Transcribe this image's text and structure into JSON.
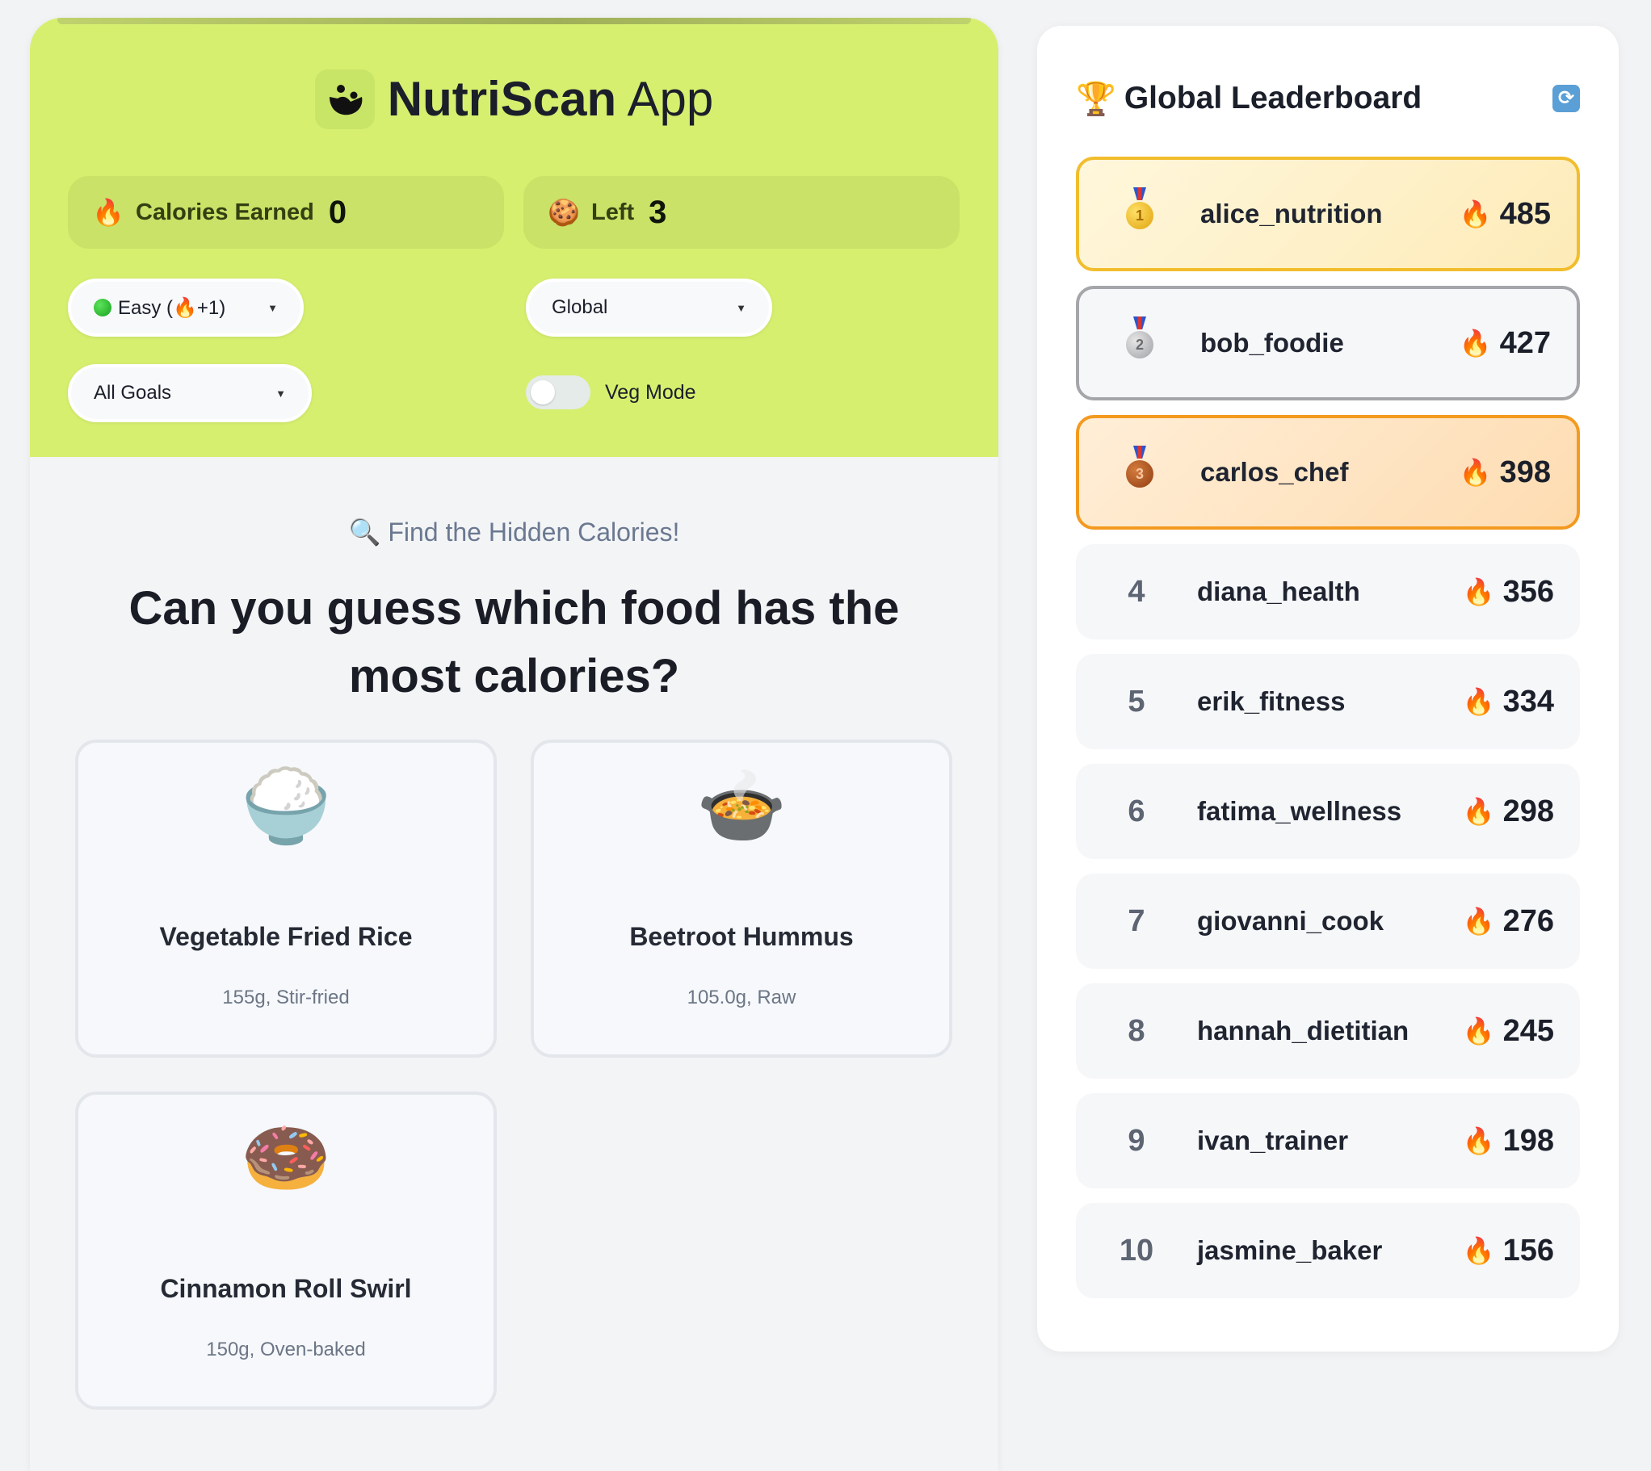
{
  "app": {
    "name": "NutriScan",
    "suffix": "App"
  },
  "stats": {
    "calories_label": "Calories Earned",
    "calories_value": "0",
    "left_label": "Left",
    "left_value": "3"
  },
  "filters": {
    "difficulty": "Easy (🔥+1)",
    "scope": "Global",
    "goals": "All Goals",
    "veg_mode_label": "Veg Mode",
    "veg_mode_on": false
  },
  "game": {
    "subtitle": "🔍 Find the Hidden Calories!",
    "question": "Can you guess which food has the most calories?",
    "foods": [
      {
        "emoji": "🍚",
        "name": "Vegetable Fried Rice",
        "detail": "155g, Stir-fried"
      },
      {
        "emoji": "🍲",
        "name": "Beetroot Hummus",
        "detail": "105.0g, Raw"
      },
      {
        "emoji": "🍩",
        "name": "Cinnamon Roll Swirl",
        "detail": "150g, Oven-baked"
      }
    ]
  },
  "leaderboard": {
    "title": "Global Leaderboard",
    "trophy": "🏆",
    "refresh_icon": "🔄",
    "fire": "🔥",
    "entries": [
      {
        "rank": "1",
        "name": "alice_nutrition",
        "score": "485"
      },
      {
        "rank": "2",
        "name": "bob_foodie",
        "score": "427"
      },
      {
        "rank": "3",
        "name": "carlos_chef",
        "score": "398"
      },
      {
        "rank": "4",
        "name": "diana_health",
        "score": "356"
      },
      {
        "rank": "5",
        "name": "erik_fitness",
        "score": "334"
      },
      {
        "rank": "6",
        "name": "fatima_wellness",
        "score": "298"
      },
      {
        "rank": "7",
        "name": "giovanni_cook",
        "score": "276"
      },
      {
        "rank": "8",
        "name": "hannah_dietitian",
        "score": "245"
      },
      {
        "rank": "9",
        "name": "ivan_trainer",
        "score": "198"
      },
      {
        "rank": "10",
        "name": "jasmine_baker",
        "score": "156"
      }
    ]
  },
  "colors": {
    "header_bg": "#d6ef6f",
    "gold": "#f2bd2d",
    "silver": "#a4a6aa",
    "bronze": "#f39a1f"
  }
}
